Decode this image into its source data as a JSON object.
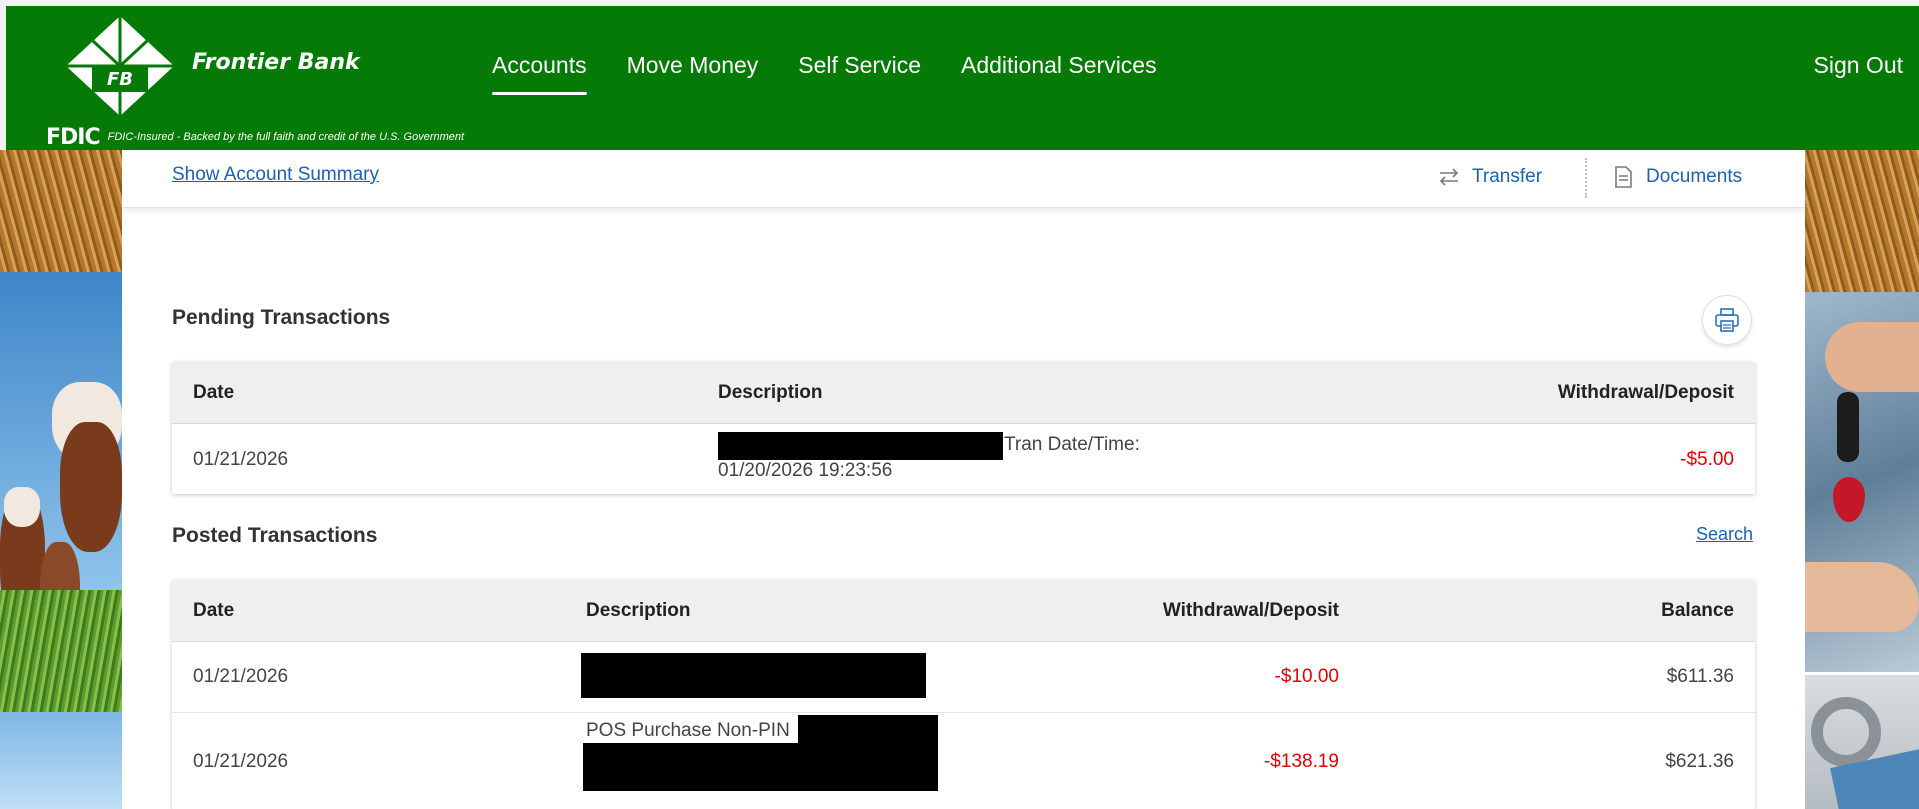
{
  "header": {
    "bank_name": "Frontier Bank",
    "logo_initials": "FB",
    "fdic_logo": "FDIC",
    "fdic_text": "FDIC-Insured - Backed by the full faith and credit of the U.S. Government",
    "nav": [
      {
        "label": "Accounts",
        "active": true
      },
      {
        "label": "Move Money",
        "active": false
      },
      {
        "label": "Self Service",
        "active": false
      },
      {
        "label": "Additional Services",
        "active": false
      }
    ],
    "sign_out": "Sign Out",
    "brand_color": "#067a06"
  },
  "subbar": {
    "show_summary": "Show Account Summary",
    "transfer": "Transfer",
    "documents": "Documents",
    "link_color": "#1a62b8"
  },
  "pending": {
    "title": "Pending Transactions",
    "columns": [
      "Date",
      "Description",
      "Withdrawal/Deposit"
    ],
    "rows": [
      {
        "date": "01/21/2026",
        "desc_line1": "Tran Date/Time:",
        "desc_line2": "01/20/2026 19:23:56",
        "amount": "-$5.00"
      }
    ]
  },
  "posted": {
    "title": "Posted Transactions",
    "search": "Search",
    "columns": [
      "Date",
      "Description",
      "Withdrawal/Deposit",
      "Balance"
    ],
    "rows": [
      {
        "date": "01/21/2026",
        "desc": "",
        "amount": "-$10.00",
        "balance": "$611.36"
      },
      {
        "date": "01/21/2026",
        "desc": "POS Purchase Non-PIN",
        "amount": "-$138.19",
        "balance": "$621.36"
      }
    ]
  },
  "icons": {
    "transfer": "transfer-arrows-icon",
    "documents": "document-icon",
    "print": "printer-icon"
  },
  "negative_color": "#e60000"
}
